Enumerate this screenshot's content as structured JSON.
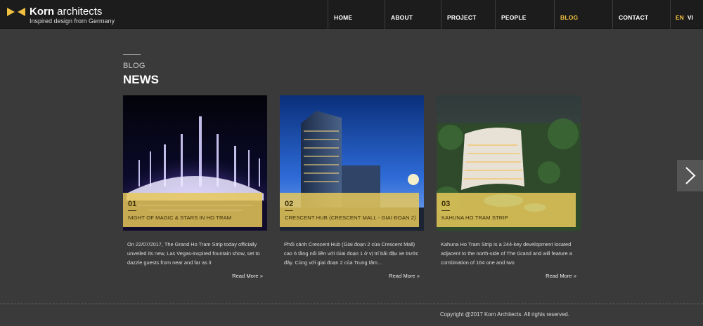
{
  "brand": {
    "name_bold": "Korn",
    "name_rest": " architects",
    "tagline": "Inspired design from Germany",
    "accent": "#f0c040"
  },
  "nav": {
    "items": [
      {
        "label": "HOME"
      },
      {
        "label": "ABOUT"
      },
      {
        "label": "PROJECT"
      },
      {
        "label": "PEOPLE"
      },
      {
        "label": "BLOG",
        "active": true
      },
      {
        "label": "CONTACT"
      }
    ],
    "lang": {
      "en": "EN",
      "vi": "VI"
    }
  },
  "section": {
    "kicker": "BLOG",
    "title": "NEWS"
  },
  "posts": [
    {
      "number": "01",
      "title": "NIGHT OF MAGIC & STARS IN HO TRAM",
      "excerpt": "On 22/07/2017, The Grand Ho Tram Strip today officially unveiled its new, Las Vegas-inspired fountain show, set to dazzle guests from near and far as it",
      "read_more": "Read More »",
      "image_icon": "fountain-photo"
    },
    {
      "number": "02",
      "title": "CRESCENT HUB (CRESCENT MALL - GIAI ĐOẠN 2)",
      "excerpt": "Phối cảnh Crescent Hub (Giai đoạn 2 của Crescent Mall) cao 6 tầng nối liền với Giai đoạn 1 ở vị trí bãi đậu xe trước đây. Cùng với giai đoạn 2 của Trung tâm...",
      "read_more": "Read More »",
      "image_icon": "tower-photo"
    },
    {
      "number": "03",
      "title": "KAHUNA HO TRAM STRIP",
      "excerpt": "Kahuna Ho Tram Strip is a 244-key development located adjacent to the north-side of The Grand and will feature a combination of 164 one and two",
      "read_more": "Read More »",
      "image_icon": "resort-photo"
    }
  ],
  "footer": {
    "copyright": "Copyright @2017 Korn Architects. All rights reserved."
  }
}
